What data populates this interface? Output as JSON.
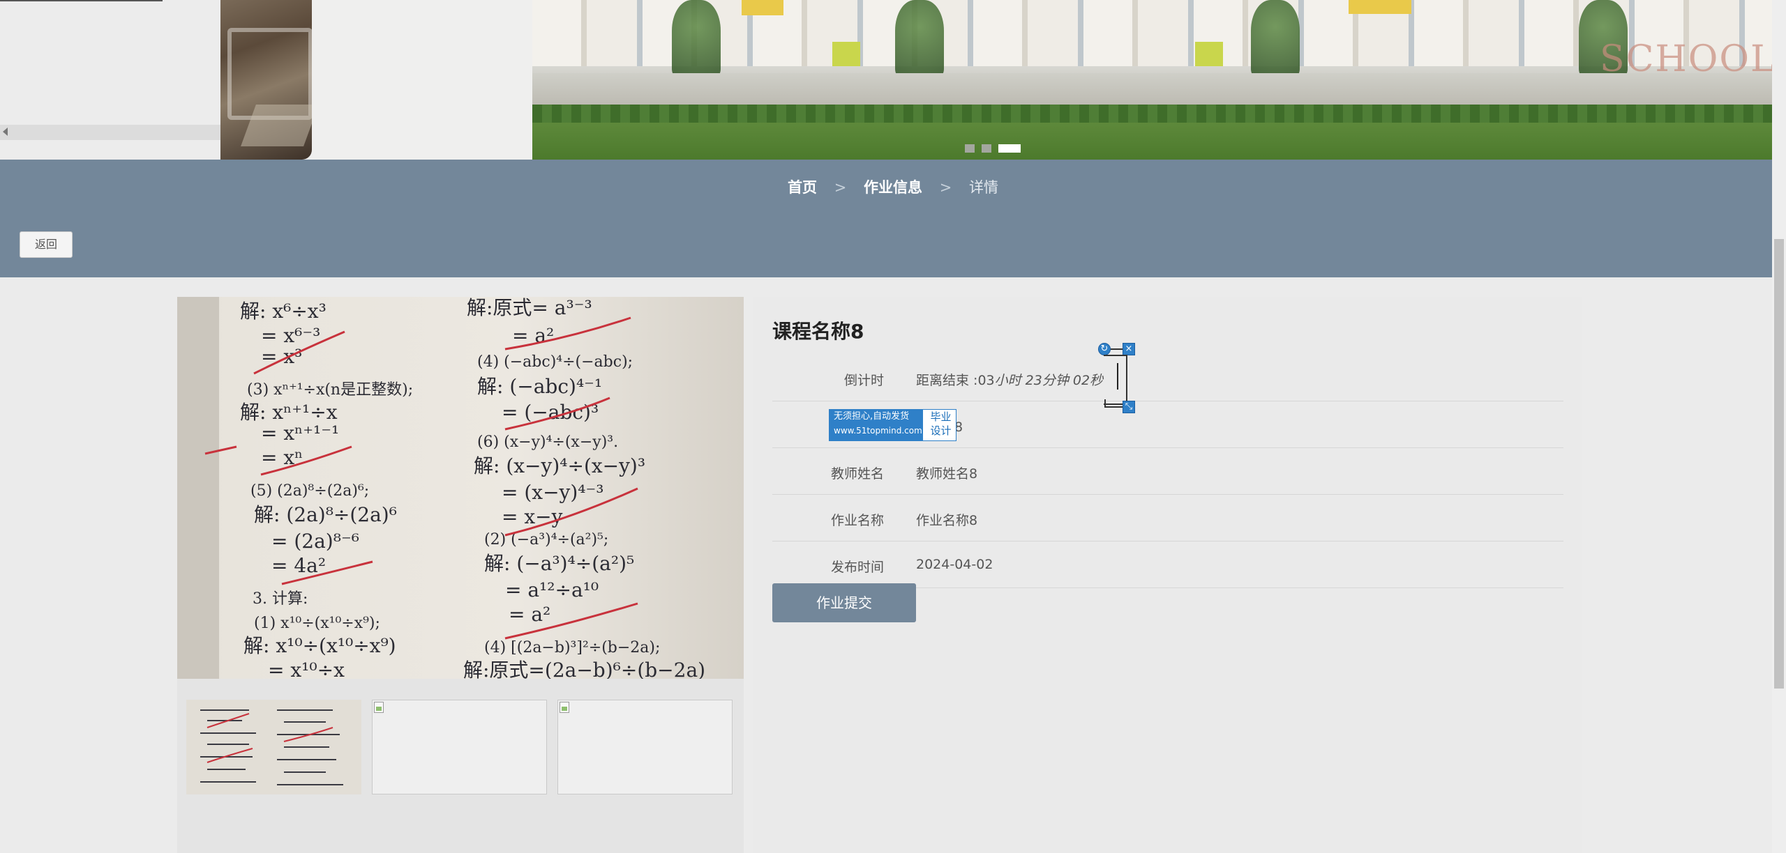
{
  "banner": {
    "carousel": {
      "total": 3,
      "active_index": 2
    },
    "school_sign": "SCHOOL"
  },
  "breadcrumb": {
    "home": "首页",
    "separator": ">",
    "section": "作业信息",
    "current": "详情"
  },
  "back_button": "返回",
  "course": {
    "title": "课程名称8"
  },
  "details": [
    {
      "label": "倒计时",
      "value_prefix": "距离结束 :03",
      "value_italic": "小时 23分钟 02秒"
    },
    {
      "label": "",
      "value": "号8"
    },
    {
      "label": "教师姓名",
      "value": "教师姓名8"
    },
    {
      "label": "作业名称",
      "value": "作业名称8"
    },
    {
      "label": "发布时间",
      "value": "2024-04-02"
    }
  ],
  "submit_button": "作业提交",
  "ad": {
    "line1": "无须担心,自动发货",
    "line2": "www.51topmind.com",
    "right": "毕业设计"
  },
  "widget": {
    "refresh_icon": "↻",
    "close_icon": "×",
    "resize_icon": "⤡"
  },
  "colors": {
    "bar": "#73879a",
    "background": "#ebebeb",
    "ad_blue": "#2f80c8"
  }
}
